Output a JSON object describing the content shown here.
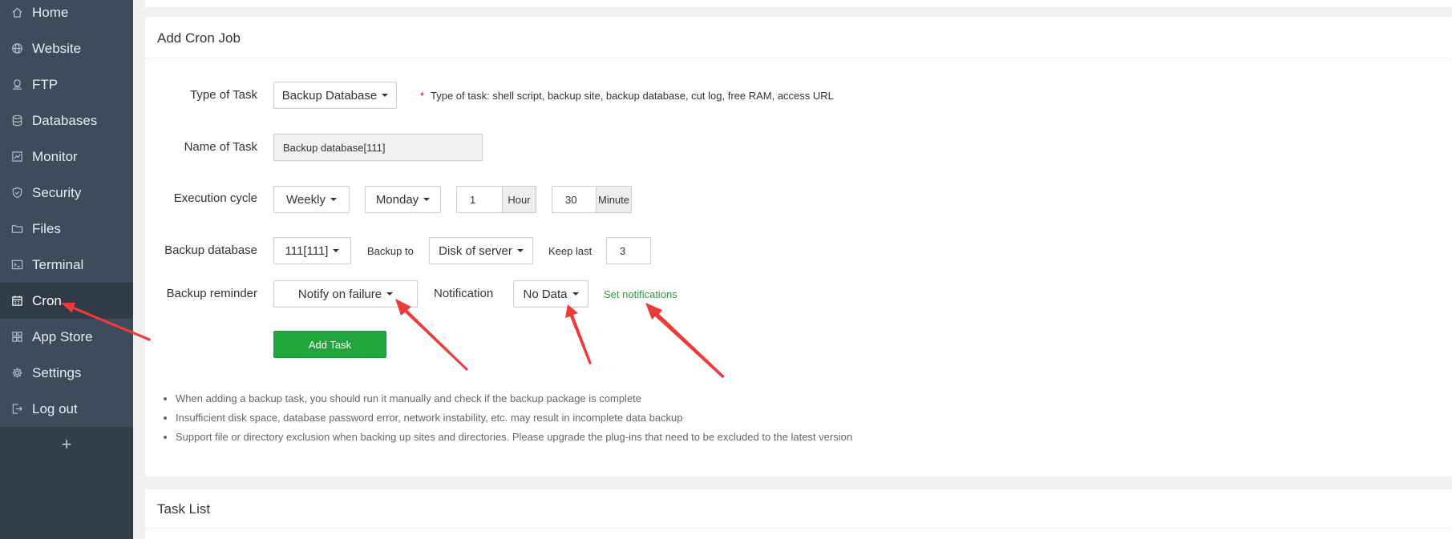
{
  "sidebar": {
    "items": [
      {
        "label": "Home",
        "icon": "home-icon"
      },
      {
        "label": "Website",
        "icon": "globe-icon"
      },
      {
        "label": "FTP",
        "icon": "ftp-icon"
      },
      {
        "label": "Databases",
        "icon": "database-icon"
      },
      {
        "label": "Monitor",
        "icon": "monitor-icon"
      },
      {
        "label": "Security",
        "icon": "shield-icon"
      },
      {
        "label": "Files",
        "icon": "folder-icon"
      },
      {
        "label": "Terminal",
        "icon": "terminal-icon"
      },
      {
        "label": "Cron",
        "icon": "calendar-icon",
        "active": true
      },
      {
        "label": "App Store",
        "icon": "apps-grid-icon"
      },
      {
        "label": "Settings",
        "icon": "gear-icon"
      },
      {
        "label": "Log out",
        "icon": "logout-icon"
      }
    ],
    "add_label": "+",
    "active_color": "#2f3b48",
    "background_color": "#3d4b5b"
  },
  "form": {
    "title": "Add Cron Job",
    "type_of_task": {
      "label": "Type of Task",
      "value": "Backup Database",
      "required_mark": "*",
      "hint": "Type of task: shell script, backup site, backup database, cut log, free RAM, access URL"
    },
    "name_of_task": {
      "label": "Name of Task",
      "value": "Backup database[111]"
    },
    "execution_cycle": {
      "label": "Execution cycle",
      "cycle": "Weekly",
      "day": "Monday",
      "hour_value": "1",
      "hour_unit": "Hour",
      "minute_value": "30",
      "minute_unit": "Minute"
    },
    "backup_database": {
      "label": "Backup database",
      "value": "111[111]",
      "backup_to_label": "Backup to",
      "backup_to_value": "Disk of server",
      "keep_last_label": "Keep last",
      "keep_last_value": "3"
    },
    "backup_reminder": {
      "label": "Backup reminder",
      "value": "Notify on failure",
      "notification_label": "Notification",
      "notification_value": "No Data",
      "set_notifications_link": "Set notifications"
    },
    "add_task_button": "Add Task",
    "tips": [
      "When adding a backup task, you should run it manually and check if the backup package is complete",
      "Insufficient disk space, database password error, network instability, etc. may result in incomplete data backup",
      "Support file or directory exclusion when backing up sites and directories. Please upgrade the plug-ins that need to be excluded to the latest version"
    ]
  },
  "task_list": {
    "title": "Task List"
  },
  "colors": {
    "accent_green": "#20a53a",
    "annotation_red": "#f03a3a",
    "required_red": "#ee0000"
  }
}
